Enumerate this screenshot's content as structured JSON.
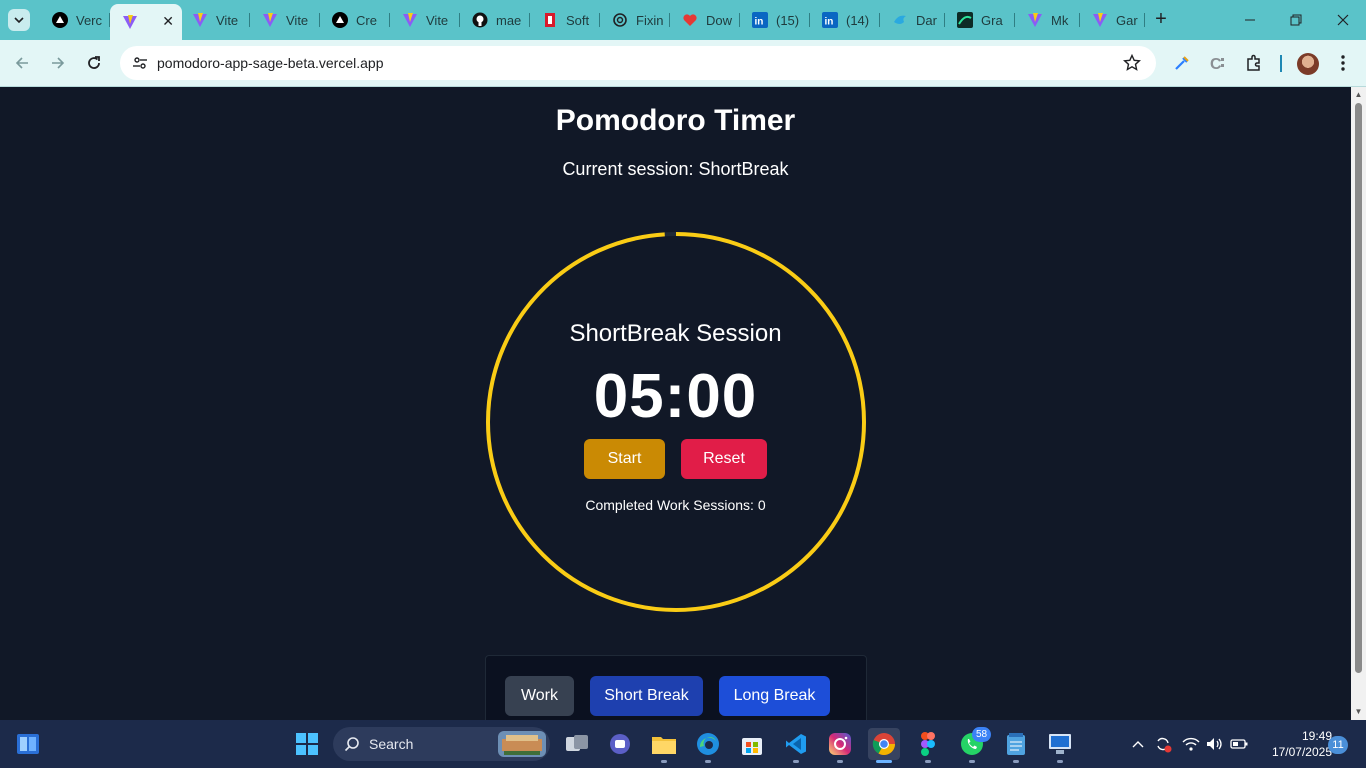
{
  "browser": {
    "tabs": [
      {
        "title": "Verc",
        "icon": "vercel-icon",
        "active": false
      },
      {
        "title": "",
        "icon": "vite-icon",
        "active": true
      },
      {
        "title": "Vite",
        "icon": "vite-icon",
        "active": false
      },
      {
        "title": "Vite",
        "icon": "vite-icon",
        "active": false
      },
      {
        "title": "Cre",
        "icon": "vercel-icon",
        "active": false
      },
      {
        "title": "Vite",
        "icon": "vite-icon",
        "active": false
      },
      {
        "title": "mae",
        "icon": "github-icon",
        "active": false
      },
      {
        "title": "Soft",
        "icon": "softonic-icon",
        "active": false
      },
      {
        "title": "Fixin",
        "icon": "openai-icon",
        "active": false
      },
      {
        "title": "Dow",
        "icon": "heart-icon",
        "active": false
      },
      {
        "title": "(15)",
        "icon": "linkedin-icon",
        "active": false
      },
      {
        "title": "(14)",
        "icon": "linkedin-icon",
        "active": false
      },
      {
        "title": "Dar",
        "icon": "bird-icon",
        "active": false
      },
      {
        "title": "Gra",
        "icon": "gradient-icon",
        "active": false
      },
      {
        "title": "Mk",
        "icon": "vite-icon",
        "active": false
      },
      {
        "title": "Gar",
        "icon": "vite-icon",
        "active": false
      }
    ],
    "url": "pomodoro-app-sage-beta.vercel.app"
  },
  "app": {
    "title": "Pomodoro Timer",
    "current_session": "Current session: ShortBreak",
    "session_label": "ShortBreak Session",
    "time_display": "05:00",
    "progress_fraction": 0.99,
    "start_label": "Start",
    "reset_label": "Reset",
    "completed_text": "Completed Work Sessions: 0",
    "modes": {
      "work": "Work",
      "short_break": "Short Break",
      "long_break": "Long Break"
    },
    "colors": {
      "background": "#111827",
      "ring": "#facc15",
      "start": "#ca8a04",
      "reset": "#e11d48",
      "work": "#374151",
      "short_break": "#1e40af",
      "long_break": "#1d4ed8"
    }
  },
  "taskbar": {
    "search_label": "Search",
    "apps": [
      "start-icon",
      "search-icon",
      "task-view-icon",
      "teams-icon",
      "file-explorer-icon",
      "edge-icon",
      "store-icon",
      "vscode-icon",
      "instagram-icon",
      "chrome-icon",
      "figma-icon",
      "whatsapp-icon",
      "notepad-icon",
      "remote-desktop-icon"
    ],
    "whatsapp_badge": "58",
    "time": "19:49",
    "date": "17/07/2025",
    "notification_count": "11"
  }
}
